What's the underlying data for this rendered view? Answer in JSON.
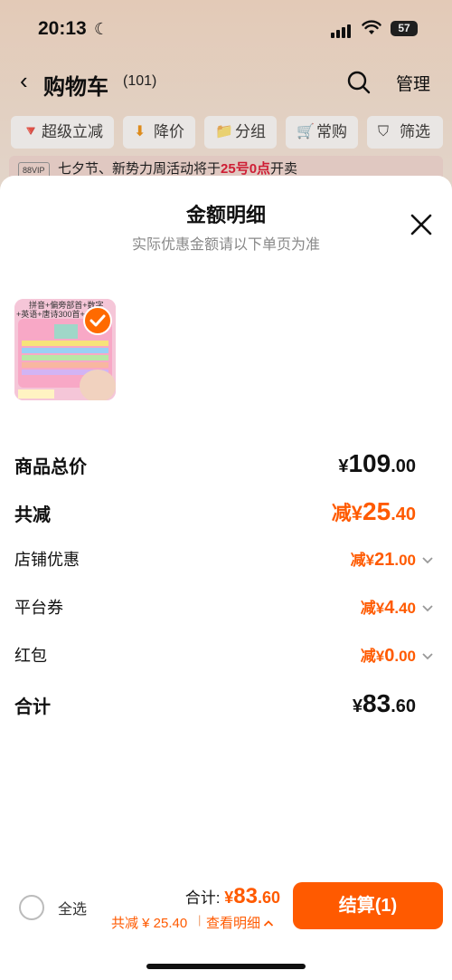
{
  "status": {
    "time": "20:13",
    "battery": "57"
  },
  "nav": {
    "title": "购物车",
    "count": "(101)",
    "manage": "管理"
  },
  "filters": [
    {
      "icon": "🔻",
      "label": "超级立减"
    },
    {
      "icon": "⬇",
      "label": "降价"
    },
    {
      "icon": "📁",
      "label": "分组"
    },
    {
      "icon": "🛒",
      "label": "常购"
    },
    {
      "icon": "⛉",
      "label": "筛选"
    }
  ],
  "promo": {
    "badge": "88VIP",
    "text_before": "七夕节、新势力周活动将于",
    "highlight": "25号0点",
    "text_after": "开卖"
  },
  "sheet": {
    "title": "金额明细",
    "subtitle": "实际优惠金额请以下单页为准",
    "product_image_text": [
      "拼音+偏旁部首+数字",
      "+英语+唐诗300首+·····识"
    ],
    "rows": {
      "total_price": {
        "label": "商品总价",
        "currency": "¥",
        "int": "109",
        "dec": ".00"
      },
      "total_reduce": {
        "label": "共减",
        "prefix": "减¥",
        "int": "25",
        "dec": ".40"
      },
      "store_discount": {
        "label": "店铺优惠",
        "prefix": "减¥",
        "int": "21",
        "dec": ".00"
      },
      "platform_coupon": {
        "label": "平台券",
        "prefix": "减¥",
        "int": "4",
        "dec": ".40"
      },
      "red_packet": {
        "label": "红包",
        "prefix": "减¥",
        "int": "0",
        "dec": ".00"
      },
      "grand_total": {
        "label": "合计",
        "currency": "¥",
        "int": "83",
        "dec": ".60"
      }
    }
  },
  "bottom": {
    "select_all": "全选",
    "total_label": "合计: ",
    "total_currency": "¥",
    "total_int": "83",
    "total_dec": ".60",
    "reduce_text": "共减 ¥ 25.40",
    "separator": "|",
    "detail_link": "查看明细",
    "checkout": "结算(1)"
  },
  "colors": {
    "accent": "#ff5a00",
    "promo_red": "#e0213a"
  }
}
